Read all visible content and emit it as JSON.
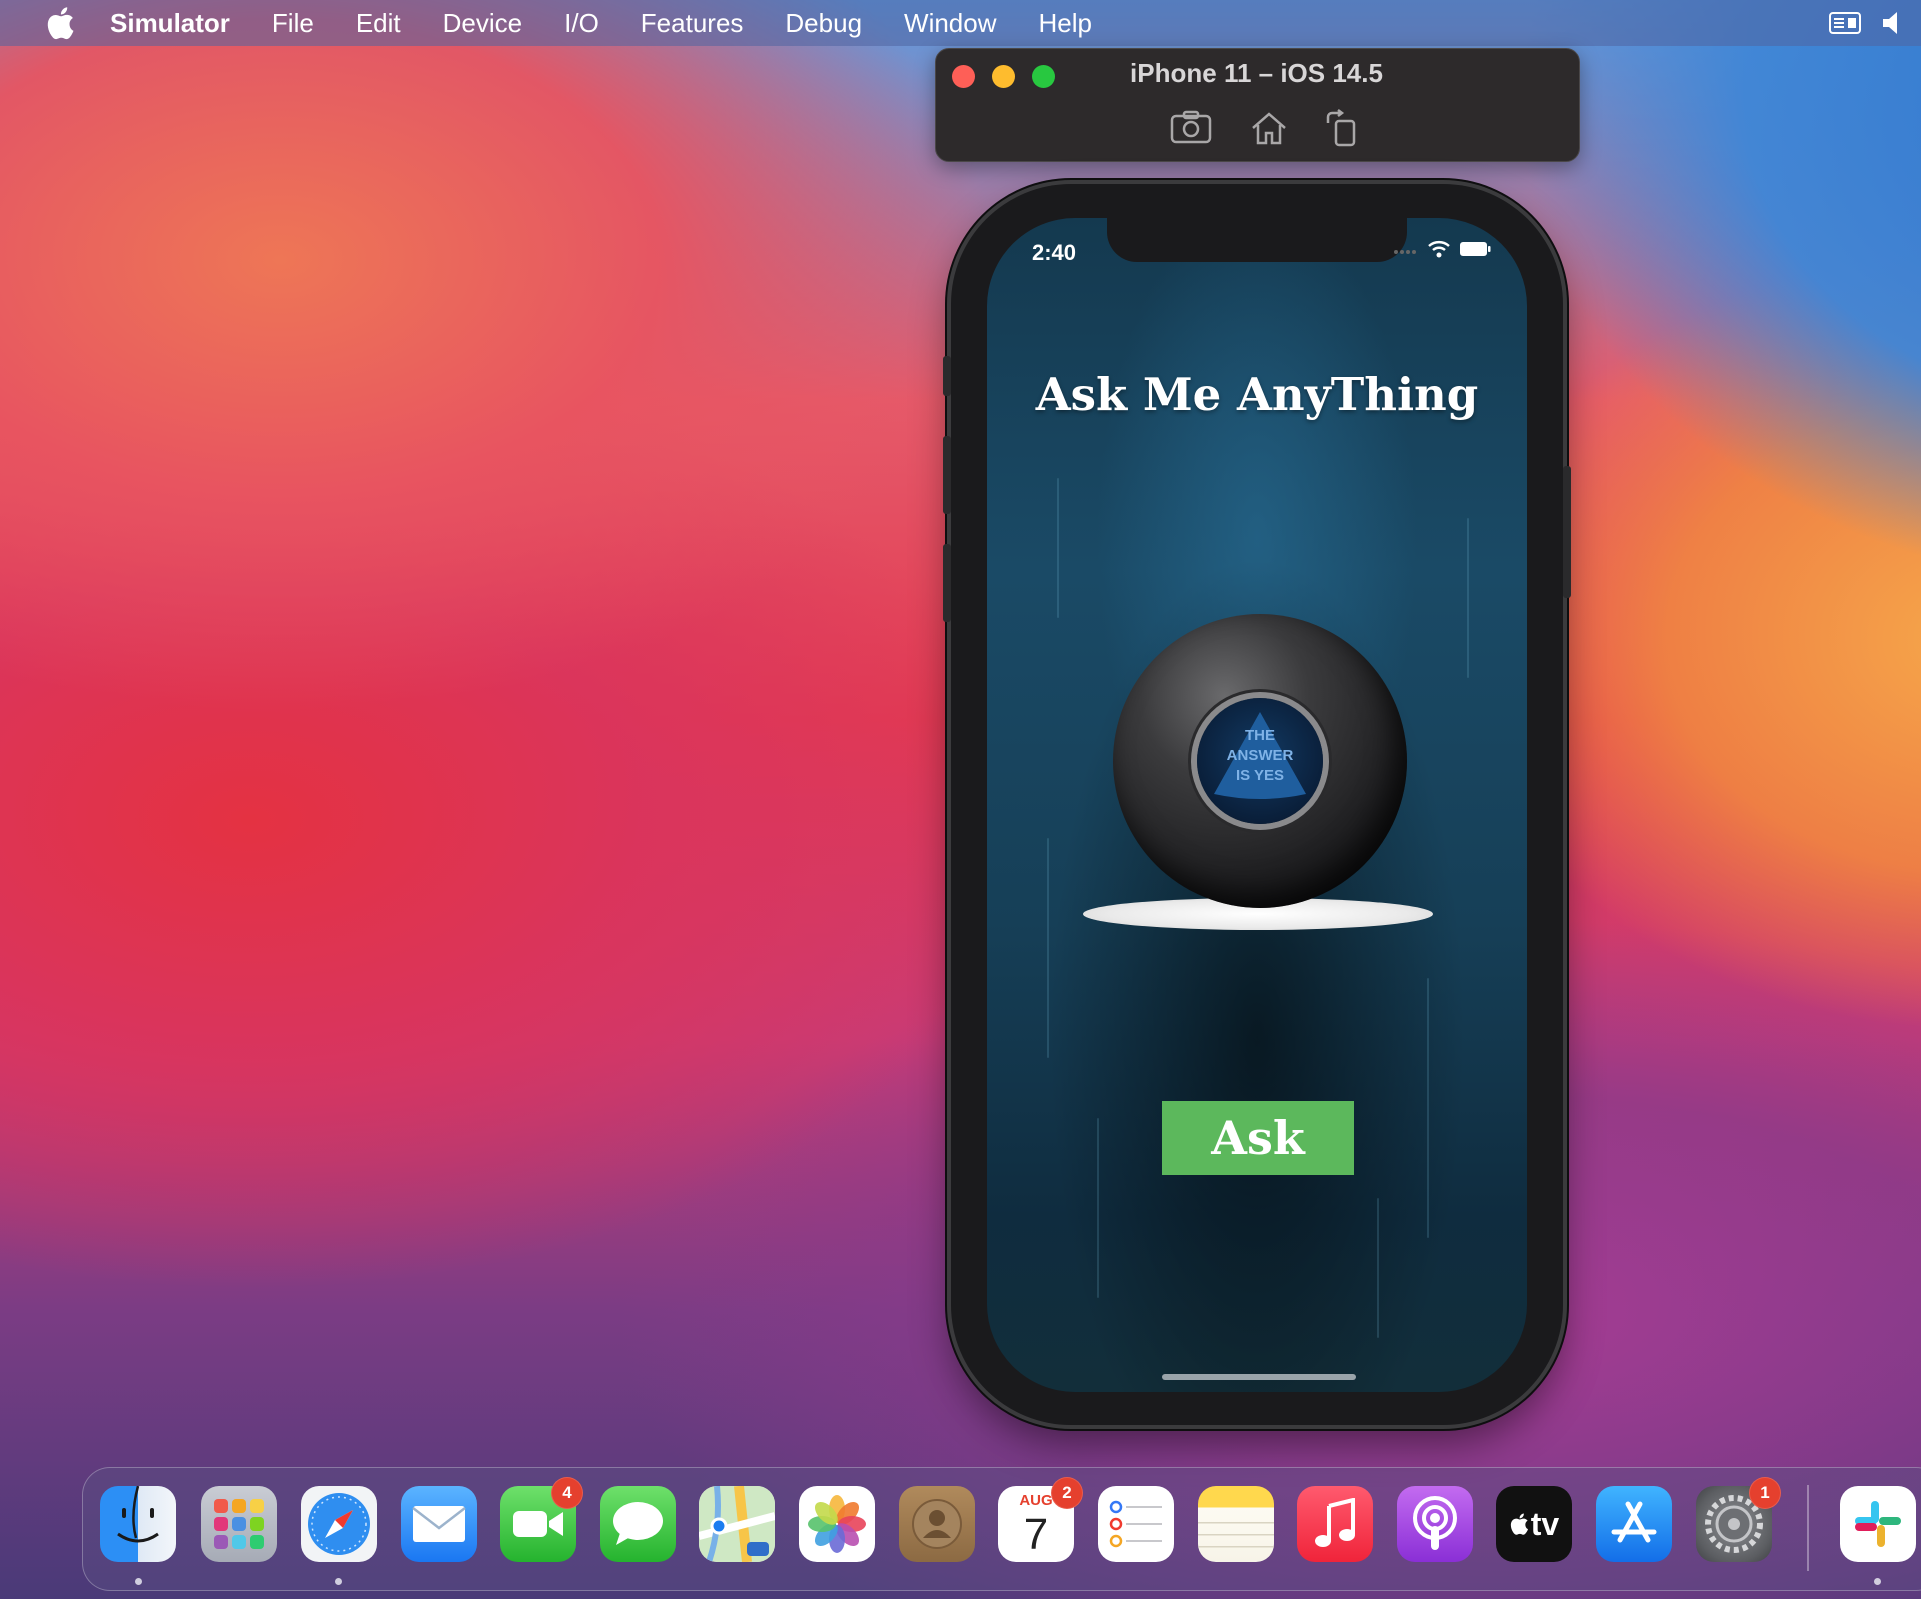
{
  "menubar": {
    "app_name": "Simulator",
    "items": [
      "File",
      "Edit",
      "Device",
      "I/O",
      "Features",
      "Debug",
      "Window",
      "Help"
    ]
  },
  "simulator": {
    "window_title": "iPhone 11 – iOS 14.5",
    "toolbar": [
      "screenshot-icon",
      "home-icon",
      "rotate-icon"
    ]
  },
  "phone": {
    "status_time": "2:40",
    "app_title": "Ask Me AnyThing",
    "ball_answer": "THE\nANSWER\nIS YES",
    "ask_button": "Ask"
  },
  "dock": {
    "apps": [
      {
        "name": "Finder",
        "icon": "finder-icon",
        "running": true
      },
      {
        "name": "Launchpad",
        "icon": "launchpad-icon"
      },
      {
        "name": "Safari",
        "icon": "safari-icon",
        "running": true
      },
      {
        "name": "Mail",
        "icon": "mail-icon"
      },
      {
        "name": "FaceTime",
        "icon": "facetime-icon",
        "badge": "4"
      },
      {
        "name": "Messages",
        "icon": "messages-icon"
      },
      {
        "name": "Maps",
        "icon": "maps-icon"
      },
      {
        "name": "Photos",
        "icon": "photos-icon"
      },
      {
        "name": "Contacts",
        "icon": "contacts-icon"
      },
      {
        "name": "Calendar",
        "icon": "calendar-icon",
        "badge": "2",
        "month": "AUG",
        "day": "7"
      },
      {
        "name": "Reminders",
        "icon": "reminders-icon"
      },
      {
        "name": "Notes",
        "icon": "notes-icon"
      },
      {
        "name": "Music",
        "icon": "music-icon"
      },
      {
        "name": "Podcasts",
        "icon": "podcasts-icon"
      },
      {
        "name": "TV",
        "icon": "tv-icon",
        "label": "tv"
      },
      {
        "name": "App Store",
        "icon": "app-store-icon"
      },
      {
        "name": "System Preferences",
        "icon": "system-preferences-icon",
        "badge": "1"
      },
      {
        "name": "Slack",
        "icon": "slack-icon",
        "running": true
      }
    ]
  },
  "colors": {
    "ask_button": "#5cb85c",
    "badge": "#e5402e",
    "traffic_close": "#fe5f57",
    "traffic_min": "#febc2e",
    "traffic_max": "#28c840"
  }
}
